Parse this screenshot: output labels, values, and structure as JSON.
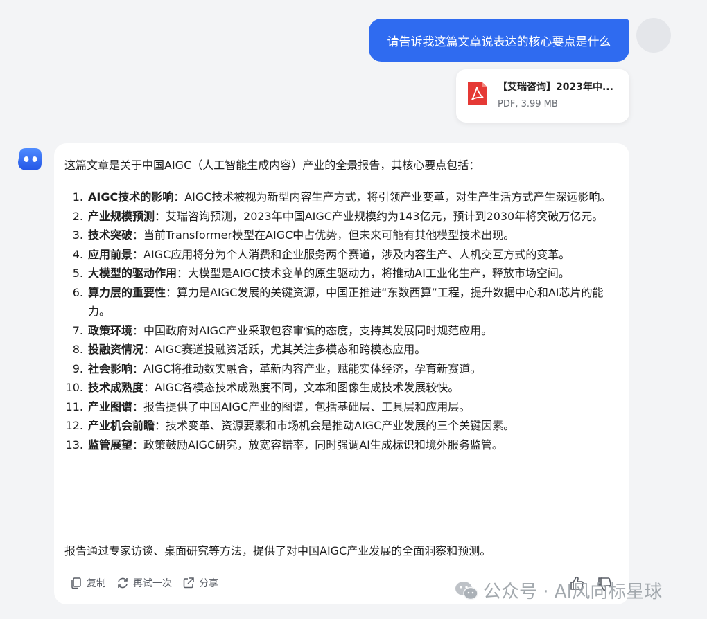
{
  "user_message": {
    "text": "请告诉我这篇文章说表达的核心要点是什么"
  },
  "attachment": {
    "file_name": "【艾瑞咨询】2023年中...",
    "meta": "PDF, 3.99 MB",
    "icon": "pdf-icon"
  },
  "answer": {
    "intro": "这篇文章是关于中国AIGC（人工智能生成内容）产业的全景报告，其核心要点包括：",
    "items": [
      {
        "num": "1.",
        "keyword": "AIGC技术的影响",
        "text": "：AIGC技术被视为新型内容生产方式，将引领产业变革，对生产生活方式产生深远影响。"
      },
      {
        "num": "2.",
        "keyword": "产业规模预测",
        "text": "：艾瑞咨询预测，2023年中国AIGC产业规模约为143亿元，预计到2030年将突破万亿元。"
      },
      {
        "num": "3.",
        "keyword": "技术突破",
        "text": "：当前Transformer模型在AIGC中占优势，但未来可能有其他模型技术出现。"
      },
      {
        "num": "4.",
        "keyword": "应用前景",
        "text": "：AIGC应用将分为个人消费和企业服务两个赛道，涉及内容生产、人机交互方式的变革。"
      },
      {
        "num": "5.",
        "keyword": "大模型的驱动作用",
        "text": "：大模型是AIGC技术变革的原生驱动力，将推动AI工业化生产，释放市场空间。"
      },
      {
        "num": "6.",
        "keyword": "算力层的重要性",
        "text": "：算力是AIGC发展的关键资源，中国正推进“东数西算”工程，提升数据中心和AI芯片的能力。"
      },
      {
        "num": "7.",
        "keyword": "政策环境",
        "text": "：中国政府对AIGC产业采取包容审慎的态度，支持其发展同时规范应用。"
      },
      {
        "num": "8.",
        "keyword": "投融资情况",
        "text": "：AIGC赛道投融资活跃，尤其关注多模态和跨模态应用。"
      },
      {
        "num": "9.",
        "keyword": "社会影响",
        "text": "：AIGC将推动数实融合，革新内容产业，赋能实体经济，孕育新赛道。"
      },
      {
        "num": "10.",
        "keyword": "技术成熟度",
        "text": "：AIGC各模态技术成熟度不同，文本和图像生成技术发展较快。"
      },
      {
        "num": "11.",
        "keyword": "产业图谱",
        "text": "：报告提供了中国AIGC产业的图谱，包括基础层、工具层和应用层。"
      },
      {
        "num": "12.",
        "keyword": "产业机会前瞻",
        "text": "：技术变革、资源要素和市场机会是推动AIGC产业发展的三个关键因素。"
      },
      {
        "num": "13.",
        "keyword": "监管展望",
        "text": "：政策鼓励AIGC研究，放宽容错率，同时强调AI生成标识和境外服务监管。"
      }
    ],
    "outro": "报告通过专家访谈、桌面研究等方法，提供了对中国AIGC产业发展的全面洞察和预测。"
  },
  "actions": {
    "copy": "复制",
    "retry": "再试一次",
    "share": "分享"
  },
  "watermark": {
    "text": "公众号 · AI风向标星球"
  },
  "colors": {
    "accent": "#2f6bf0",
    "pdf_red": "#e53935",
    "background": "#f3f4f6"
  }
}
